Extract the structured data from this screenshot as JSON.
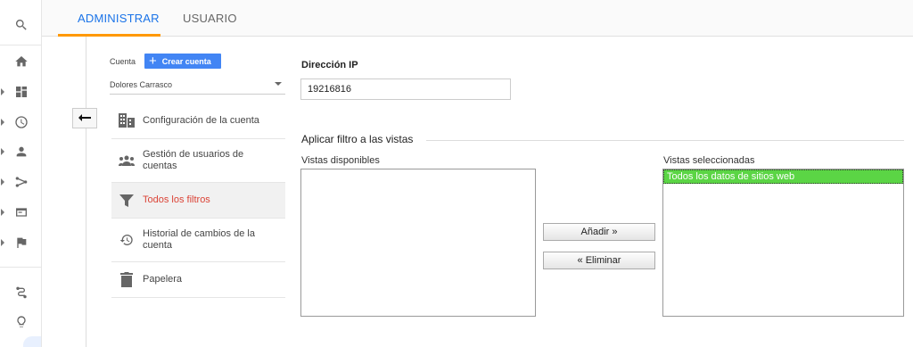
{
  "rail": {
    "items": [
      {
        "icon": "search-icon"
      },
      {
        "icon": "home-icon"
      },
      {
        "icon": "dashboard-icon"
      },
      {
        "icon": "clock-icon"
      },
      {
        "icon": "person-icon"
      },
      {
        "icon": "acquisition-icon"
      },
      {
        "icon": "behavior-icon"
      },
      {
        "icon": "flag-icon"
      },
      {
        "icon": "attribution-icon"
      },
      {
        "icon": "lightbulb-icon"
      }
    ]
  },
  "tabs": [
    {
      "label": "ADMINISTRAR",
      "active": true
    },
    {
      "label": "USUARIO",
      "active": false
    }
  ],
  "account": {
    "label": "Cuenta",
    "create_label": "Crear cuenta",
    "selected": "Dolores Carrasco"
  },
  "menu": [
    {
      "label": "Configuración de la cuenta",
      "icon": "building-icon",
      "active": false
    },
    {
      "label": "Gestión de usuarios de cuentas",
      "icon": "users-icon",
      "active": false
    },
    {
      "label": "Todos los filtros",
      "icon": "filter-icon",
      "active": true
    },
    {
      "label": "Historial de cambios de la cuenta",
      "icon": "history-icon",
      "active": false
    },
    {
      "label": "Papelera",
      "icon": "trash-icon",
      "active": false
    }
  ],
  "form": {
    "ip_label": "Dirección IP",
    "ip_value": "19216816",
    "filter_title": "Aplicar filtro a las vistas",
    "available_label": "Vistas disponibles",
    "available_items": [],
    "selected_label": "Vistas seleccionadas",
    "selected_items": [
      "Todos los datos de sitios web"
    ],
    "add_label": "Añadir »",
    "remove_label": "« Eliminar"
  },
  "colors": {
    "accent": "#1a73e8",
    "tab_underline": "#ff9800",
    "active_menu": "#db4437",
    "selected_view": "#5bd545",
    "create_button": "#4285f4"
  }
}
